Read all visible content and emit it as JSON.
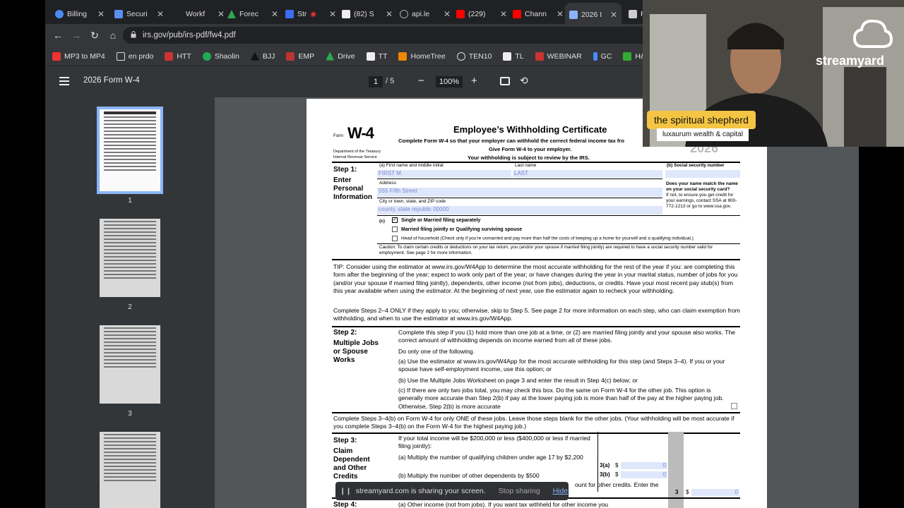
{
  "tabs": [
    {
      "title": "Billing",
      "color": "#4a8af4"
    },
    {
      "title": "Securi",
      "color": "#5b8ff0"
    },
    {
      "title": "Workf",
      "color": "#555"
    },
    {
      "title": "Forec",
      "color": "#2da94f"
    },
    {
      "title": "Str",
      "color": "#3a6ff0"
    },
    {
      "title": "(82) S",
      "color": "#eee"
    },
    {
      "title": "api.le",
      "color": "#aaa"
    },
    {
      "title": "(229)",
      "color": "#f00"
    },
    {
      "title": "Chann",
      "color": "#f00"
    },
    {
      "title": "2026 I",
      "color": "#8ab4f8"
    },
    {
      "title": "R",
      "color": "#ccc"
    }
  ],
  "browser": {
    "url": "irs.gov/pub/irs-pdf/fw4.pdf"
  },
  "bookmarks": [
    "MP3 to MP4",
    "en prdo",
    "HTT",
    "Shaolin",
    "BJJ",
    "EMP",
    "Drive",
    "TT",
    "HomeTree",
    "TEN10",
    "TL",
    "WEBINAR",
    "GC",
    "H&S"
  ],
  "pdf": {
    "title": "2026 Form W-4",
    "page": "1",
    "of": "/  5",
    "zoom": "100%"
  },
  "thumbs": [
    "1",
    "2",
    "3"
  ],
  "form": {
    "form_word": "Form",
    "form_name": "W-4",
    "dept": "Department of the Treasury",
    "irs": "Internal Revenue Service",
    "title": "Employee’s Withholding Certificate",
    "sub1": "Complete Form W-4 so that your employer can withhold the correct federal income tax fro",
    "sub2": "Give Form W-4 to your employer.",
    "sub3": "Your withholding is subject to review by the IRS.",
    "year": "2026",
    "step1": "Step 1:",
    "step1_desc": "Enter Personal Information",
    "a_label": "(a)   First name and middle initial",
    "last_label": "Last name",
    "b_label": "(b)   Social security number",
    "first_val": "FIRST M",
    "last_val": "LAST",
    "address_label": "Address",
    "address_val": "555 Fifth Street",
    "city_label": "City or town, state, and ZIP code",
    "city_val": "county, state republic 00000",
    "name_match": "Does your name match the name on your social security card?",
    "name_match2": "If not, to ensure you get credit for your earnings, contact SSA at 800-772-1213 or go to www.ssa.gov.",
    "c_label": "(c)",
    "opt1": "Single or Married filing separately",
    "opt2": "Married filing jointly or Qualifying surviving spouse",
    "opt3": "Head of household (Check only if you’re unmarried and pay more than half the costs of keeping up a home for yourself and a qualifying individual.)",
    "caution": "Caution: To claim certain credits or deductions on your tax return, you (and/or your spouse if married filing jointly) are required to have a social security number valid for employment. See page 2 for more information.",
    "tip": "TIP: Consider using the estimator at www.irs.gov/W4App to determine the most accurate withholding for the rest of the year if you: are completing this form after the beginning of the year; expect to work only part of the year; or have changes during the year in your marital status, number of jobs for you (and/or your spouse if married filing jointly), dependents, other income (not from jobs), deductions, or credits. Have your most recent pay stub(s) from this year available when using the estimator. At the beginning of next year, use the estimator again to recheck your withholding.",
    "complete24": "Complete Steps 2–4 ONLY if they apply to you; otherwise, skip to Step 5. See page 2 for more information on each step, who can claim exemption from withholding, and when to use the estimator at www.irs.gov/W4App.",
    "step2": "Step 2:",
    "step2_desc": "Multiple Jobs or Spouse Works",
    "step2_text": "Complete this step if you (1) hold more than one job at a time, or (2) are married filing jointly and your spouse also works. The correct amount of withholding depends on income earned from all of these jobs.",
    "do_one": "Do only one of the following.",
    "s2a": "(a)  Use the estimator at www.irs.gov/W4App for the most accurate withholding for this step (and Steps 3–4). If you or your spouse have self-employment income, use this option; or",
    "s2b": "(b)  Use the Multiple Jobs Worksheet on page 3 and enter the result in Step 4(c) below; or",
    "s2c": "(c)  If there are only two jobs total, you may check this box. Do the same on Form W-4 for the other job. This option is generally more accurate than Step 2(b) if pay at the lower paying job is more than half of the pay at the higher paying job. Otherwise, Step 2(b) is more accurate",
    "complete34": "Complete Steps 3–4(b) on Form W-4 for only ONE of these jobs. Leave those steps blank for the other jobs. (Your withholding will be most accurate if you complete Steps 3–4(b) on the Form W-4 for the highest paying job.)",
    "step3": "Step 3:",
    "step3_desc": "Claim Dependent and Other Credits",
    "s3_intro": "If your total income will be $200,000 or less ($400,000 or less if married filing jointly):",
    "s3a": "(a)  Multiply the number of qualifying children under age 17 by $2,200",
    "s3b": "(b)  Multiply the number of other dependents by $500",
    "s3c": "ount for other credits. Enter the",
    "l3a": "3(a)",
    "l3b": "3(b)",
    "l3": "3",
    "dollar": "$",
    "zero": "0",
    "step4": "Step 4:",
    "s4": "(a) Other income (not from jobs). If you want tax withheld for other income you"
  },
  "stream": {
    "brand": "streamyard",
    "name": "the spiritual shepherd",
    "subtitle": "luxaurum wealth & capital"
  },
  "share": {
    "text": "streamyard.com is sharing your screen.",
    "stop": "Stop sharing",
    "hide": "Hide"
  }
}
